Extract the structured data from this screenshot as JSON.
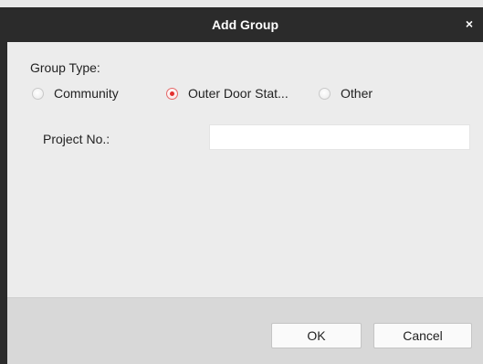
{
  "dialog": {
    "title": "Add Group",
    "close_glyph": "×"
  },
  "group_type": {
    "label": "Group Type:",
    "options": [
      {
        "label": "Community",
        "selected": false
      },
      {
        "label": "Outer Door Stat...",
        "selected": true
      },
      {
        "label": "Other",
        "selected": false
      }
    ]
  },
  "project_no": {
    "label": "Project No.:",
    "value": "",
    "placeholder": ""
  },
  "buttons": {
    "ok_label": "OK",
    "cancel_label": "Cancel"
  },
  "colors": {
    "titlebar": "#2b2b2b",
    "radio_selected": "#e3302f",
    "footer": "#d8d8d8"
  }
}
